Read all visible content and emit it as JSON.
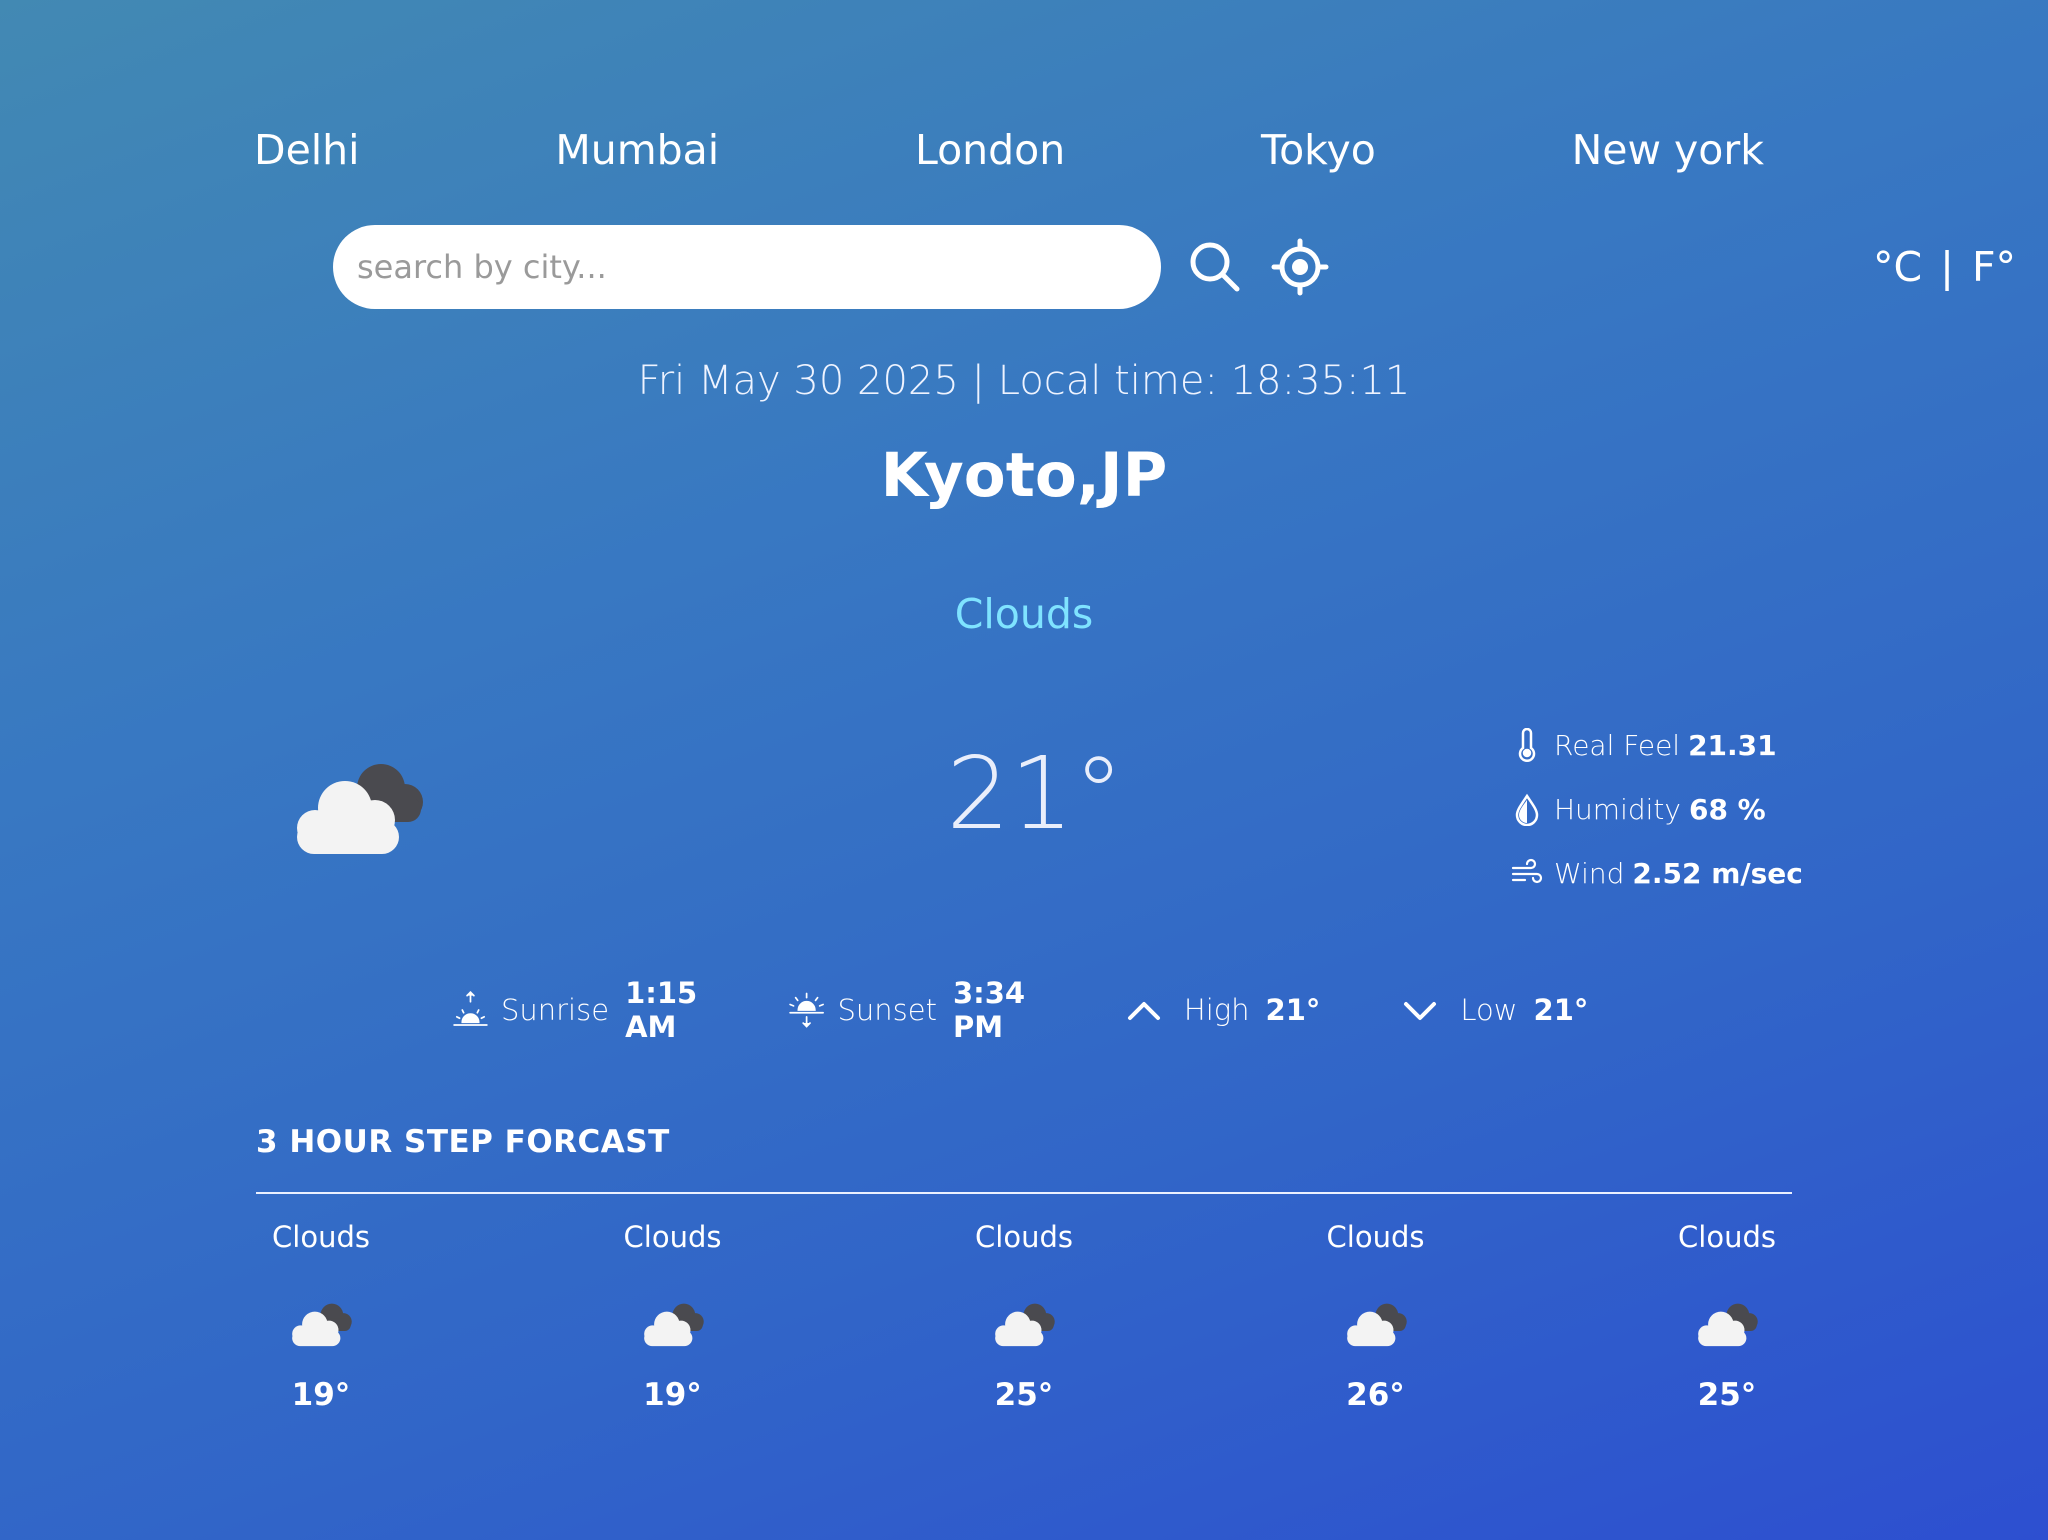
{
  "nav": {
    "cities": [
      "Delhi",
      "Mumbai",
      "London",
      "Tokyo",
      "New york"
    ]
  },
  "search": {
    "placeholder": "search by city...",
    "value": ""
  },
  "units": {
    "celsius": "°C",
    "separator": "|",
    "fahrenheit": "F°"
  },
  "header": {
    "datetime": "Fri May 30 2025 | Local time: 18:35:11",
    "location": "Kyoto,JP",
    "condition": "Clouds"
  },
  "current": {
    "temperature": "21°",
    "icon": "cloud-icon",
    "details": {
      "real_feel_label": "Real Feel",
      "real_feel_value": "21.31",
      "humidity_label": "Humidity",
      "humidity_value": "68 %",
      "wind_label": "Wind",
      "wind_value": "2.52 m/sec"
    }
  },
  "sun": {
    "sunrise_label": "Sunrise",
    "sunrise_value": "1:15 AM",
    "sunset_label": "Sunset",
    "sunset_value": "3:34 PM",
    "high_label": "High",
    "high_value": "21°",
    "low_label": "Low",
    "low_value": "21°"
  },
  "forecast": {
    "title": "3 HOUR STEP FORCAST",
    "items": [
      {
        "condition": "Clouds",
        "temp": "19°"
      },
      {
        "condition": "Clouds",
        "temp": "19°"
      },
      {
        "condition": "Clouds",
        "temp": "25°"
      },
      {
        "condition": "Clouds",
        "temp": "26°"
      },
      {
        "condition": "Clouds",
        "temp": "25°"
      }
    ]
  },
  "colors": {
    "condition_accent": "#7fe3ff",
    "background_start": "#4289b3",
    "background_end": "#2d4fd0"
  }
}
